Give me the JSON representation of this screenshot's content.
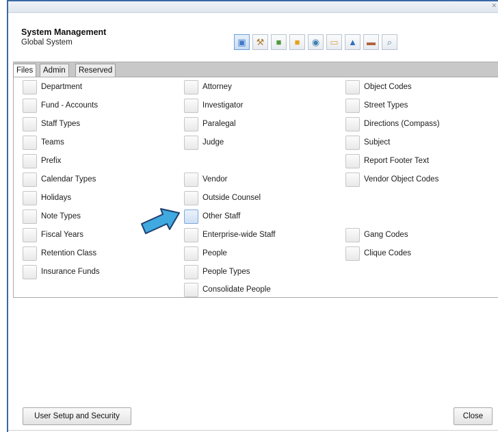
{
  "window": {
    "close_glyph": "✕"
  },
  "header": {
    "title": "System Management",
    "subtitle": "Global System"
  },
  "toolbar": {
    "icons": [
      {
        "name": "system-icon",
        "glyph": "▣",
        "color": "#3f78c8"
      },
      {
        "name": "gavel-icon",
        "glyph": "⚒",
        "color": "#b07a2a"
      },
      {
        "name": "book-icon",
        "glyph": "■",
        "color": "#4f9a3a"
      },
      {
        "name": "folder-icon",
        "glyph": "■",
        "color": "#e3a320"
      },
      {
        "name": "globe-icon",
        "glyph": "◉",
        "color": "#3a7fb0"
      },
      {
        "name": "people-icon",
        "glyph": "▭",
        "color": "#d7a24a"
      },
      {
        "name": "lock-icon",
        "glyph": "▲",
        "color": "#2f6fbf"
      },
      {
        "name": "handshake-icon",
        "glyph": "▬",
        "color": "#b3613a"
      },
      {
        "name": "search-document-icon",
        "glyph": "⌕",
        "color": "#5a7fa8"
      }
    ]
  },
  "tabs": {
    "files": "Files",
    "admin": "Admin",
    "reserved": "Reserved"
  },
  "columns": {
    "col1": [
      "Department",
      "Fund - Accounts",
      "Staff Types",
      "Teams",
      "Prefix",
      "Calendar Types",
      "Holidays",
      "Note Types",
      "Fiscal Years",
      "Retention Class",
      "Insurance Funds"
    ],
    "col2": [
      "Attorney",
      "Investigator",
      "Paralegal",
      "Judge",
      "Vendor",
      "Outside Counsel",
      "Other Staff",
      "Enterprise-wide Staff",
      "People",
      "People Types",
      "Consolidate People"
    ],
    "col3": [
      "Object Codes",
      "Street Types",
      "Directions (Compass)",
      "Subject",
      "Report Footer Text",
      "Vendor Object Codes",
      "Gang Codes",
      "Clique Codes"
    ]
  },
  "footer": {
    "user_setup_label": "User Setup and Security",
    "close_label": "Close"
  },
  "colors": {
    "window_border": "#3a67a6",
    "arrow_fill": "#3fa9e0",
    "arrow_stroke": "#1f3f6e"
  }
}
